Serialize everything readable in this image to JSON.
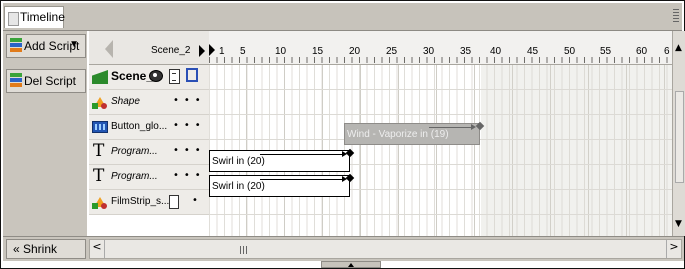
{
  "panel": {
    "title": "Timeline"
  },
  "sidebar": {
    "add_script": "Add Script",
    "del_script": "Del Script",
    "shrink": "« Shrink"
  },
  "scene_nav": {
    "name": "Scene_2"
  },
  "ruler": {
    "numbers": [
      "1",
      "5",
      "10",
      "15",
      "20",
      "25",
      "30",
      "35",
      "40",
      "45",
      "50",
      "55",
      "60",
      "6"
    ]
  },
  "layers": [
    {
      "name": "Scene_1",
      "icon": "scene-icon"
    },
    {
      "name": "Shape",
      "icon": "shape-icon"
    },
    {
      "name": "Button_glo...",
      "icon": "button-icon"
    },
    {
      "name": "Program...",
      "icon": "text-icon"
    },
    {
      "name": "Program...",
      "icon": "text-icon"
    },
    {
      "name": "FilmStrip_s...",
      "icon": "shape-icon"
    }
  ],
  "tweens": {
    "wind": "Wind - Vaporize in (19)",
    "swirl1": "Swirl in (20)",
    "swirl2": "Swirl in (20)"
  },
  "colors": {
    "panel_bg": "#c9c5bd",
    "tween_grey": "#b6b5b2",
    "accent_blue": "#2a4fb5"
  }
}
